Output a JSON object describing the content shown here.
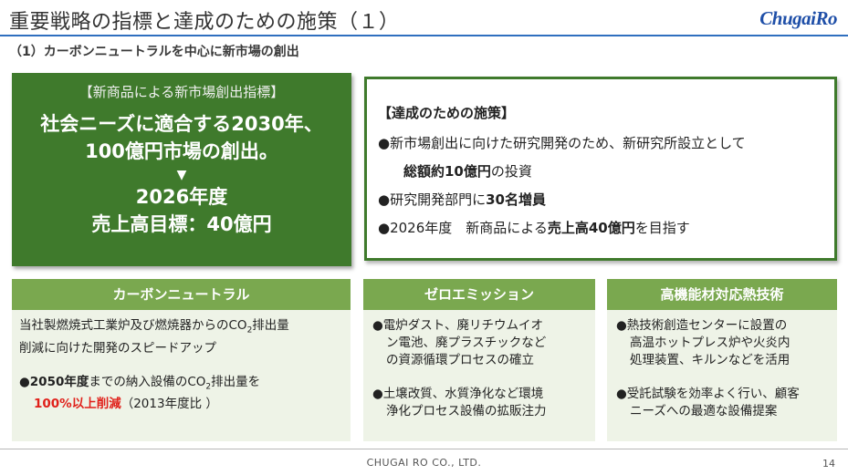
{
  "header": {
    "title": "重要戦略の指標と達成のための施策（１）",
    "logo": "ChugaiRo",
    "subtitle": "（1）カーボンニュートラルを中心に新市場の創出"
  },
  "indicator": {
    "heading": "【新商品による新市場創出指標】",
    "line1": "社会ニーズに適合する2030年、",
    "line2": "100億円市場の創出。",
    "arrow": "▼",
    "line3": "2026年度",
    "line4": "売上高目標：40億円"
  },
  "measures": {
    "heading": "【達成のための施策】",
    "b1_text": "●新市場創出に向けた研究開発のため、新研究所設立として",
    "b1_bold": "総額約10億円",
    "b1_tail": "の投資",
    "b2_text": "●研究開発部門に",
    "b2_bold": "30名増員",
    "b3_text": "●2026年度　新商品による",
    "b3_bold": "売上高40億円",
    "b3_tail": "を目指す"
  },
  "columns": {
    "carbon": {
      "header": "カーボンニュートラル",
      "p1a": "当社製燃焼式工業炉及び燃焼器からのCO",
      "p1sub": "2",
      "p1b": "排出量",
      "p1c": "削減に向けた開発のスピードアップ",
      "p2a": "●",
      "p2bold": "2050年度",
      "p2b": "までの納入設備のCO",
      "p2sub": "2",
      "p2c": "排出量を",
      "p2red": "100%以上削減",
      "p2d": "（2013年度比 ）"
    },
    "zero": {
      "header": "ゼロエミッション",
      "b1l1": "●電炉ダスト、廃リチウムイオ",
      "b1l2": "ン電池、廃プラスチックなど",
      "b1l3": "の資源循環プロセスの確立",
      "b2l1": "●土壌改質、水質浄化など環境",
      "b2l2": "浄化プロセス設備の拡販注力"
    },
    "thermal": {
      "header": "高機能材対応熱技術",
      "b1l1": "●熱技術創造センターに設置の",
      "b1l2": "高温ホットプレス炉や火炎内",
      "b1l3": "処理装置、キルンなどを活用",
      "b2l1": "●受託試験を効率よく行い、顧客",
      "b2l2": "ニーズへの最適な設備提案"
    }
  },
  "footer": {
    "company": "CHUGAI RO CO., LTD.",
    "page": "14"
  },
  "colors": {
    "dark_green": "#3f7a2c",
    "light_green": "#7aa84f",
    "pale_green": "#eef3e7",
    "accent_red": "#e0201a",
    "rule_blue": "#2f6fbf",
    "logo_blue": "#1f4fa8"
  }
}
